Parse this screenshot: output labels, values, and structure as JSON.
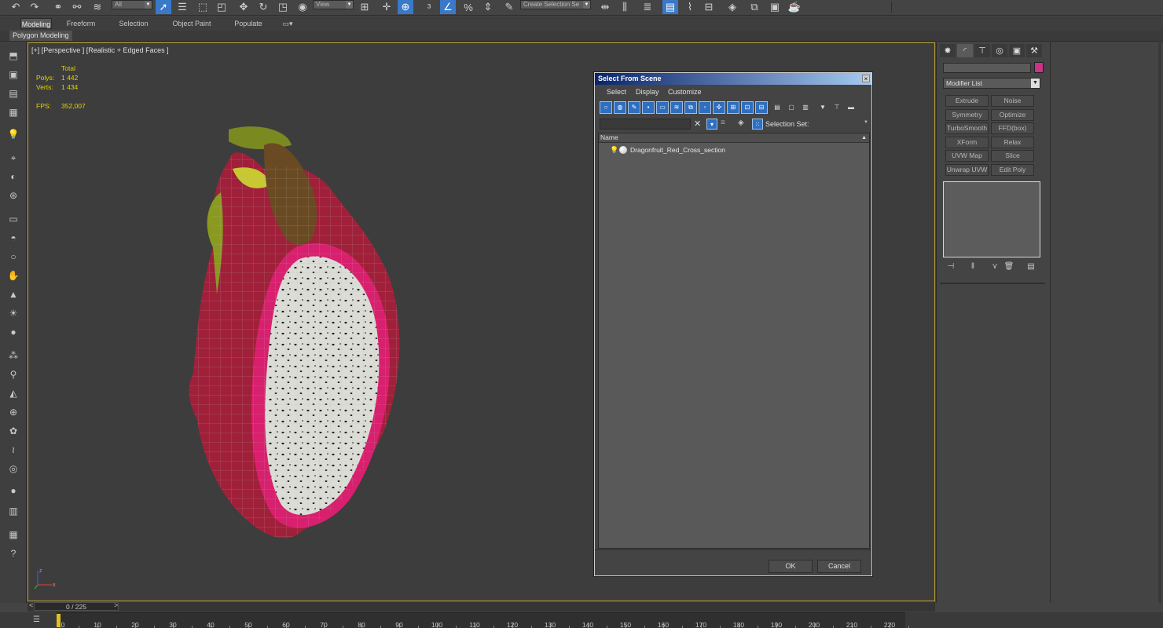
{
  "toolbar": {
    "filter_dropdown": "All",
    "refcoord_dropdown": "View",
    "selset_dropdown": "Create Selection Se"
  },
  "ribbon": {
    "tabs": [
      "Modeling",
      "Freeform",
      "Selection",
      "Object Paint",
      "Populate"
    ],
    "active_tab": "Modeling",
    "sub_label": "Polygon Modeling"
  },
  "viewport": {
    "label": "[+] [Perspective ] [Realistic + Edged Faces ]",
    "stats_header": "Total",
    "polys_label": "Polys:",
    "polys_value": "1 442",
    "verts_label": "Verts:",
    "verts_value": "1 434",
    "fps_label": "FPS:",
    "fps_value": "352,007",
    "gizmo_z": "z",
    "gizmo_x": "x"
  },
  "timeline": {
    "frame_display": "0 / 225",
    "prev": "<",
    "next": ">",
    "ticks": [
      "0",
      "10",
      "20",
      "30",
      "40",
      "50",
      "60",
      "70",
      "80",
      "90",
      "100",
      "110",
      "120",
      "130",
      "140",
      "150",
      "160",
      "170",
      "180",
      "190",
      "200",
      "210",
      "220"
    ]
  },
  "command_panel": {
    "modifier_list": "Modifier List",
    "buttons": [
      "Extrude",
      "Noise",
      "Symmetry",
      "Optimize",
      "TurboSmooth",
      "FFD(box)",
      "XForm",
      "Relax",
      "UVW Map",
      "Slice",
      "Unwrap UVW",
      "Edit Poly"
    ],
    "object_color": "#cc3388"
  },
  "dialog": {
    "title": "Select From Scene",
    "close": "×",
    "menu": [
      "Select",
      "Display",
      "Customize"
    ],
    "selection_set_label": "Selection Set:",
    "column_name": "Name",
    "items": [
      "Dragonfruit_Red_Cross_section"
    ],
    "ok_label": "OK",
    "cancel_label": "Cancel"
  }
}
